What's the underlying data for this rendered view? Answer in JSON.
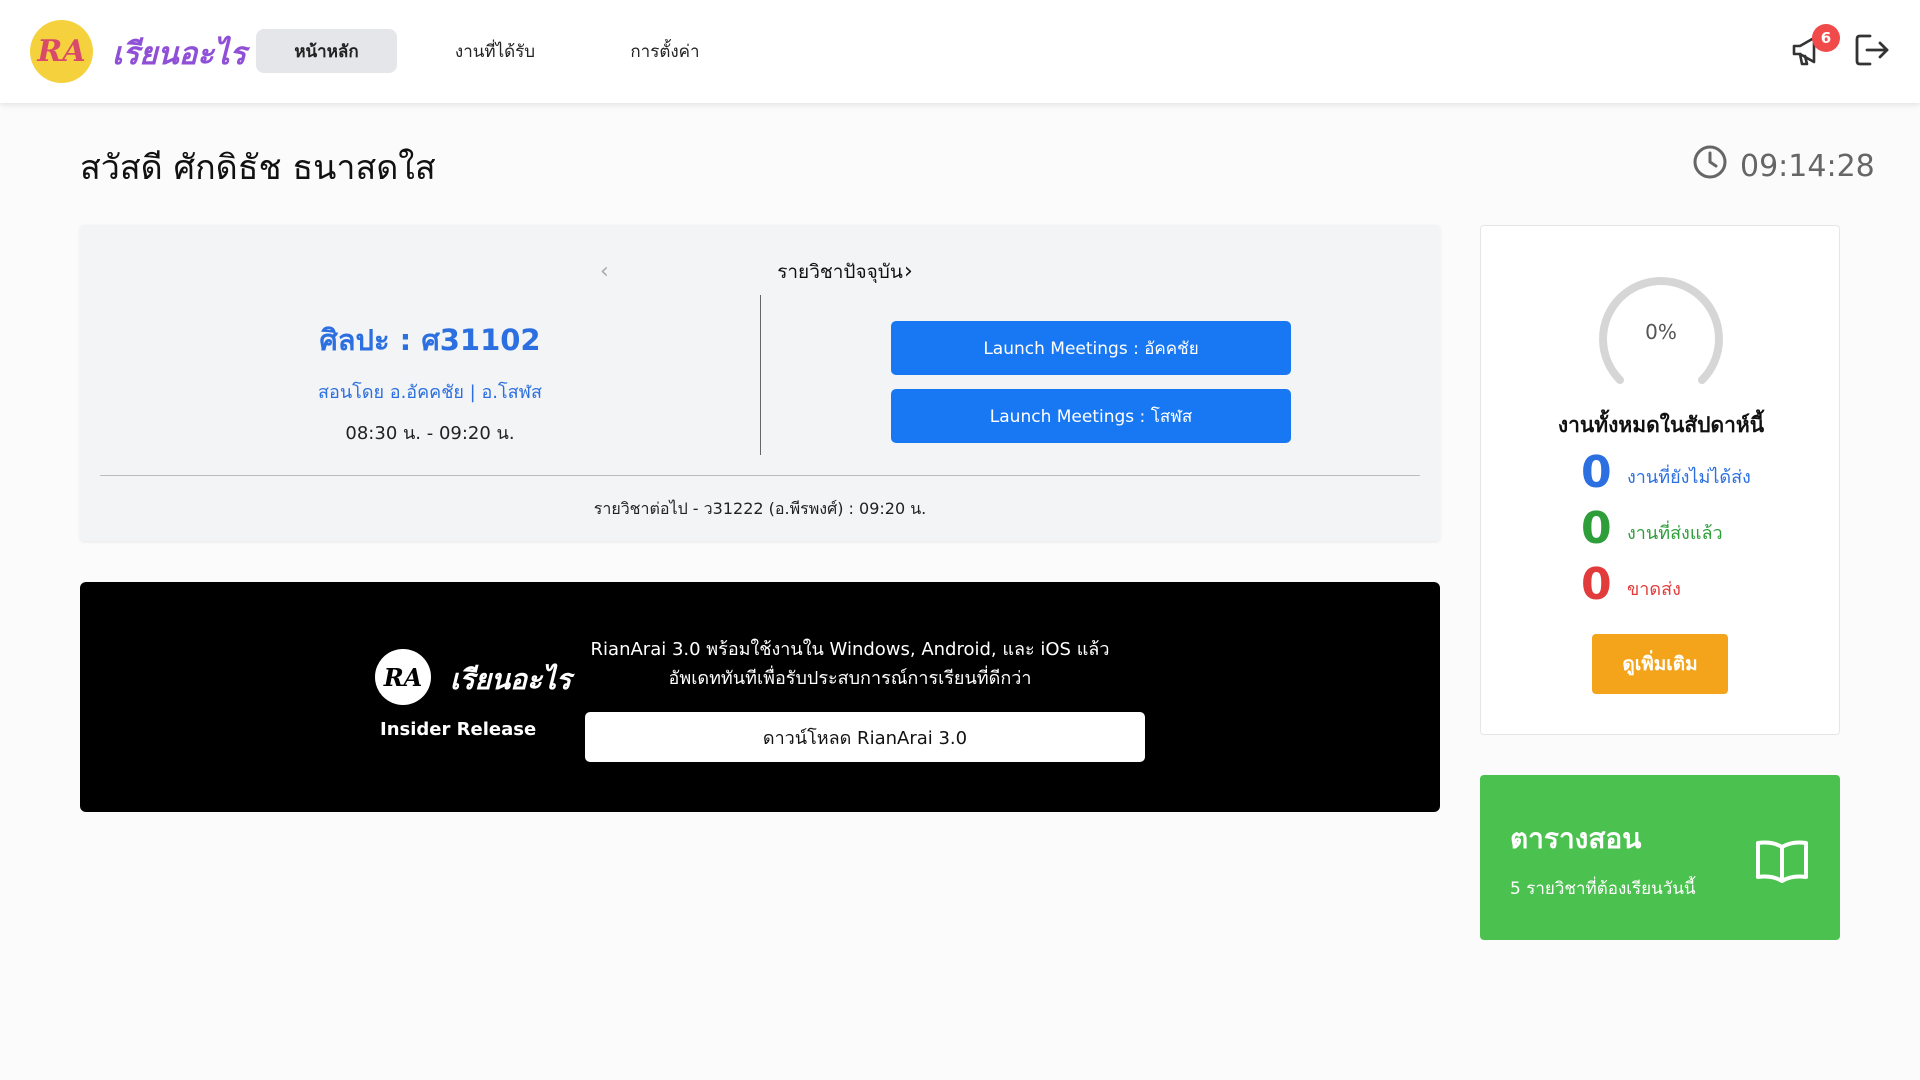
{
  "app": {
    "logo_text": "RA",
    "brand": "เรียนอะไร"
  },
  "nav": {
    "tabs": [
      {
        "label": "หน้าหลัก",
        "active": true
      },
      {
        "label": "งานที่ได้รับ",
        "active": false
      },
      {
        "label": "การตั้งค่า",
        "active": false
      }
    ],
    "notification_count": "6",
    "notification_icon": "megaphone-icon",
    "logout_icon": "logout-icon"
  },
  "greeting": "สวัสดี ศักดิธัช ธนาสดใส",
  "clock": {
    "icon": "clock-icon",
    "time": "09:14:28"
  },
  "current_subject": {
    "nav_title": "รายวิชาปัจจุบัน",
    "prev_icon": "‹",
    "next_icon": "›",
    "subject": "ศิลปะ : ศ31102",
    "teachers": "สอนโดย อ.อัคคชัย | อ.โสฬส",
    "time": "08:30 น. - 09:20 น.",
    "launch_buttons": [
      "Launch Meetings : อัคคชัย",
      "Launch Meetings : โสฬส"
    ],
    "next_subject": "รายวิชาต่อไป - ว31222 (อ.พีรพงศ์) : 09:20 น."
  },
  "banner": {
    "logo_text": "RA",
    "brand": "เรียนอะไร",
    "tag": "Insider Release",
    "line1": "RianArai 3.0 พร้อมใช้งานใน Windows, Android, และ iOS แล้ว",
    "line2": "อัพเดททันทีเพื่อรับประสบการณ์การเรียนที่ดีกว่า",
    "download_label": "ดาวน์โหลด RianArai 3.0"
  },
  "weekly_stats": {
    "progress_percent": 0,
    "progress_label": "0%",
    "title": "งานทั้งหมดในสัปดาห์นี้",
    "items": [
      {
        "count": "0",
        "label": "งานที่ยังไม่ได้ส่ง",
        "color": "#2b6fe0"
      },
      {
        "count": "0",
        "label": "งานที่ส่งแล้ว",
        "color": "#2e9e3a"
      },
      {
        "count": "0",
        "label": "ขาดส่ง",
        "color": "#e23b3b"
      }
    ],
    "more_label": "ดูเพิ่มเติม"
  },
  "schedule": {
    "title": "ตารางสอน",
    "subtitle": "5 รายวิชาที่ต้องเรียนวันนี้",
    "icon": "book-icon"
  },
  "colors": {
    "primary": "#1877f2",
    "accent_orange": "#f4a41b",
    "schedule_green": "#4bc14f",
    "brand_purple": "#8f4fd6",
    "logo_yellow": "#f5d13e",
    "badge_red": "#f04a4a"
  }
}
